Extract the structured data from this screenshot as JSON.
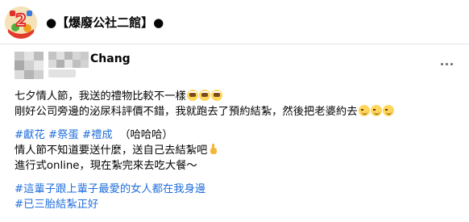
{
  "group": {
    "title": "●【爆廢公社二館】●",
    "logo_icon": "group-logo-icon"
  },
  "post": {
    "author": "Chang",
    "paragraph1": {
      "line1": "七夕情人節，我送的禮物比較不一樣",
      "line2": "剛好公司旁邊的泌尿科評價不錯，我就跑去了預約結紮，然後把老婆約去"
    },
    "tags1": [
      "#獻花",
      "#祭蛋",
      "#禮成"
    ],
    "laugh": "（哈哈哈）",
    "line4": "情人節不知道要送什麼，送自己去結紮吧",
    "line5": "進行式online，現在紮完來去吃大餐～",
    "tag_line1": "#這輩子跟上輩子最愛的女人都在我身邊",
    "tag_line2": "#已三胎結紮正好"
  },
  "icons": {
    "more": "more-options-icon",
    "shocked_emoji": "shocked-face-emoji-icon",
    "wink_emoji": "winking-face-emoji-icon",
    "pinch_emoji": "pinching-hand-emoji-icon"
  },
  "colors": {
    "hashtag": "#216fdb",
    "text": "#050505",
    "muted": "#65676b"
  }
}
